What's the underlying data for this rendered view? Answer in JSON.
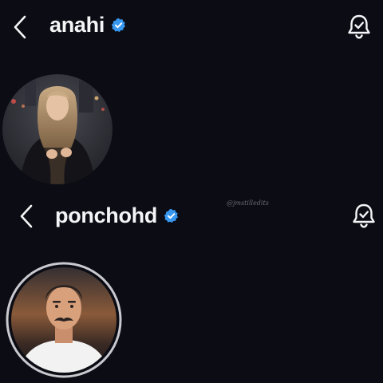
{
  "profiles": [
    {
      "username": "anahi",
      "verified": true,
      "icons": {
        "back": "chevron-left-icon",
        "badge": "verified-badge-icon",
        "notify": "bell-check-icon"
      }
    },
    {
      "username": "ponchohd",
      "verified": true,
      "icons": {
        "back": "chevron-left-icon",
        "badge": "verified-badge-icon",
        "notify": "bell-check-icon"
      }
    }
  ],
  "watermark": "@jmstilledits",
  "colors": {
    "background": "#0b0c14",
    "verified_blue": "#3897f0",
    "text": "#f5f5f7"
  }
}
